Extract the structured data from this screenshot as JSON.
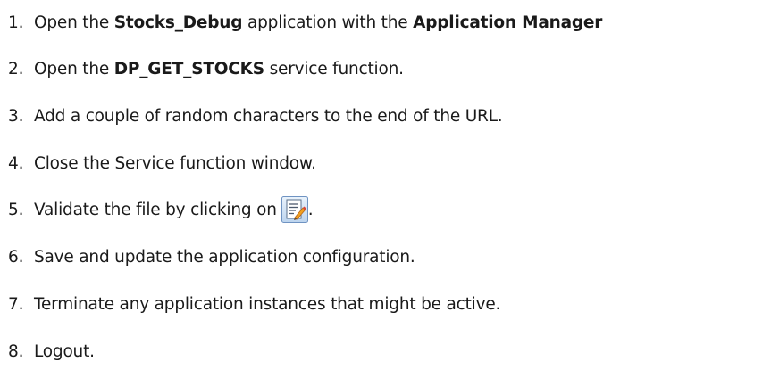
{
  "steps": [
    {
      "number": "1.",
      "parts": [
        "Open the ",
        "Stocks_Debug",
        " application with the ",
        "Application Manager"
      ]
    },
    {
      "number": "2.",
      "parts": [
        "Open the ",
        "DP_GET_STOCKS",
        " service function."
      ]
    },
    {
      "number": "3.",
      "text": "Add a couple of random characters to the end of the URL."
    },
    {
      "number": "4.",
      "text": "Close the Service function window."
    },
    {
      "number": "5.",
      "text_before_icon": "Validate the file by clicking on",
      "icon": "validate-icon",
      "text_after_icon": "."
    },
    {
      "number": "6.",
      "text": "Save and update the application configuration."
    },
    {
      "number": "7.",
      "text": "Terminate any application instances that might be active."
    },
    {
      "number": "8.",
      "text": "Logout."
    }
  ]
}
